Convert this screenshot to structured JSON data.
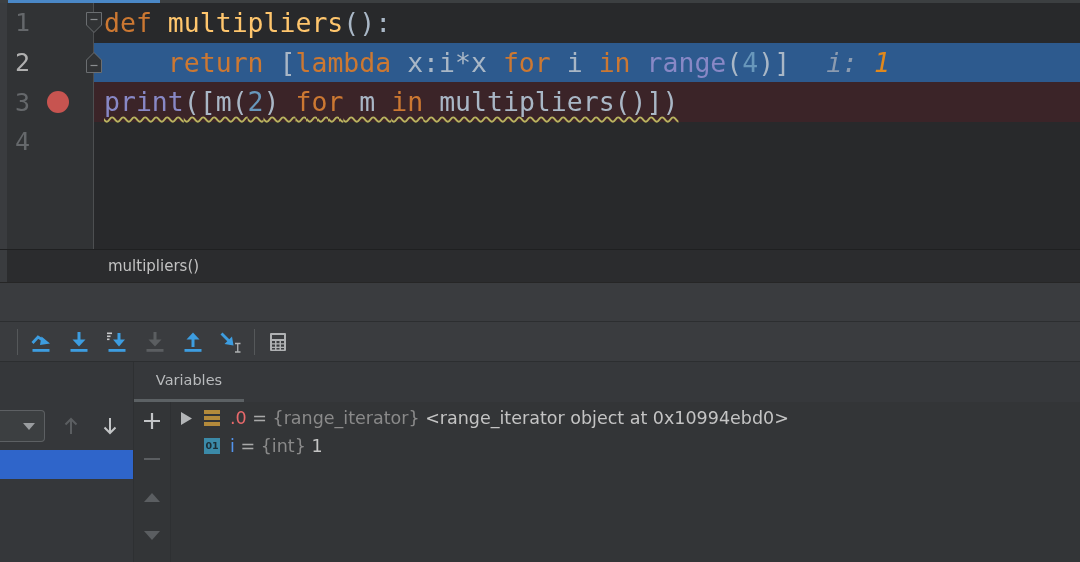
{
  "editor": {
    "lines": [
      {
        "number": "1",
        "kind": "plain",
        "fold": {
          "kind": "start"
        },
        "breakpoint": false,
        "tokens": [
          {
            "kind": "keyword",
            "text": "def"
          },
          {
            "kind": "function",
            "text": " multipliers"
          },
          {
            "kind": "plain",
            "text": "():"
          }
        ]
      },
      {
        "number": "2",
        "kind": "execution",
        "fold": {
          "kind": "end"
        },
        "breakpoint": false,
        "tokens": [
          {
            "kind": "keyword",
            "text": "    return"
          },
          {
            "kind": "plain",
            "text": " ["
          },
          {
            "kind": "keyword",
            "text": "lambda"
          },
          {
            "kind": "plain",
            "text": " x:i*x "
          },
          {
            "kind": "keyword",
            "text": "for"
          },
          {
            "kind": "plain",
            "text": " i "
          },
          {
            "kind": "keyword",
            "text": "in"
          },
          {
            "kind": "builtin",
            "text": " range"
          },
          {
            "kind": "plain",
            "text": "("
          },
          {
            "kind": "number",
            "text": "4"
          },
          {
            "kind": "plain",
            "text": ")]"
          }
        ],
        "inline_value": {
          "name": "i:",
          "value": "1"
        }
      },
      {
        "number": "3",
        "kind": "breakpoint",
        "breakpoint": true,
        "inspection": {
          "kind": "weak_warning"
        },
        "tokens": [
          {
            "kind": "builtin",
            "text": "print"
          },
          {
            "kind": "plain",
            "text": "([m("
          },
          {
            "kind": "number",
            "text": "2"
          },
          {
            "kind": "plain",
            "text": ") "
          },
          {
            "kind": "keyword",
            "text": "for"
          },
          {
            "kind": "plain",
            "text": " m "
          },
          {
            "kind": "keyword",
            "text": "in"
          },
          {
            "kind": "plain",
            "text": " multipliers()])"
          }
        ]
      },
      {
        "number": "4",
        "kind": "plain",
        "breakpoint": false
      }
    ]
  },
  "breadcrumb": [
    "multipliers()"
  ],
  "debug_toolbar": {
    "groups": [
      [
        {
          "kind": "step_over",
          "disabled": false
        },
        {
          "kind": "step_into",
          "disabled": false
        },
        {
          "kind": "step_into_my_code",
          "disabled": false
        },
        {
          "kind": "force_step_into",
          "disabled": true
        },
        {
          "kind": "step_out",
          "disabled": false
        },
        {
          "kind": "run_to_cursor",
          "disabled": false
        }
      ],
      [
        {
          "kind": "evaluate",
          "disabled": false
        }
      ]
    ]
  },
  "frames": {
    "nav": [
      {
        "kind": "up",
        "disabled": true
      },
      {
        "kind": "down",
        "disabled": false
      }
    ],
    "items": [
      {
        "selected": true
      }
    ]
  },
  "variables": {
    "tab": {
      "label": "Variables",
      "selected": true
    },
    "actions": [
      {
        "kind": "add",
        "disabled": false
      },
      {
        "kind": "remove",
        "disabled": true
      },
      {
        "kind": "move_up",
        "disabled": true
      },
      {
        "kind": "move_down",
        "disabled": true
      }
    ],
    "rows": [
      {
        "kind": "iterator",
        "expandable": true,
        "expanded": false,
        "name": ".0",
        "separator": "=",
        "type": "{range_iterator}",
        "value": "<range_iterator object at 0x10994ebd0>"
      },
      {
        "kind": "int",
        "expandable": false,
        "badge": "01",
        "name": "i",
        "separator": "=",
        "type": "{int}",
        "value": "1"
      }
    ]
  }
}
